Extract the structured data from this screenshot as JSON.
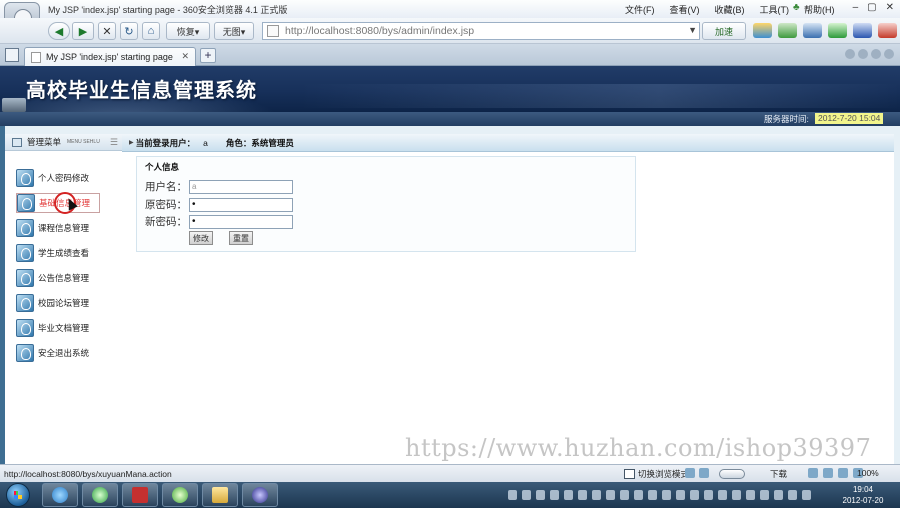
{
  "browser": {
    "window_title": "My JSP 'index.jsp' starting page - 360安全浏览器 4.1 正式版",
    "menu": [
      "文件(F)",
      "查看(V)",
      "收藏(B)",
      "工具(T)",
      "帮助(H)"
    ],
    "toolbar": {
      "restore_label": "恢复▾",
      "no_image_label": "无图▾",
      "accelerate_label": "加速"
    },
    "address": {
      "url": "http://localhost:8080/bys/admin/index.jsp"
    },
    "tab": {
      "title": "My JSP 'index.jsp' starting page"
    },
    "status": {
      "url": "http://localhost:8080/bys/xuyuanMana.action",
      "switch_mode": "切换浏览模式",
      "download": "下载",
      "zoom": "100%"
    }
  },
  "app": {
    "title": "高校毕业生信息管理系统",
    "server_time_label": "服务器时间:",
    "server_time_value": "2012-7-20 15:04",
    "sidebar": {
      "title": "管理菜单",
      "subtitle": "MENU SEHLU",
      "items": [
        {
          "label": "个人密码修改"
        },
        {
          "label": "基础信息管理",
          "active": true
        },
        {
          "label": "课程信息管理"
        },
        {
          "label": "学生成绩查看"
        },
        {
          "label": "公告信息管理"
        },
        {
          "label": "校园论坛管理"
        },
        {
          "label": "毕业文档管理"
        },
        {
          "label": "安全退出系统"
        }
      ]
    },
    "header": {
      "current_user_label": "当前登录用户：",
      "current_user_value": "a",
      "role_label": "角色：",
      "role_value": "系统管理员"
    },
    "form": {
      "legend": "个人信息",
      "username_label": "用户名：",
      "username_value": "a",
      "old_password_label": "原密码：",
      "old_password_value": "•",
      "new_password_label": "新密码：",
      "new_password_value": "•",
      "modify_label": "修改",
      "reset_label": "重置"
    }
  },
  "watermark": "https://www.huzhan.com/ishop39397",
  "taskbar": {
    "clock_time": "19:04",
    "clock_date": "2012-07-20"
  }
}
